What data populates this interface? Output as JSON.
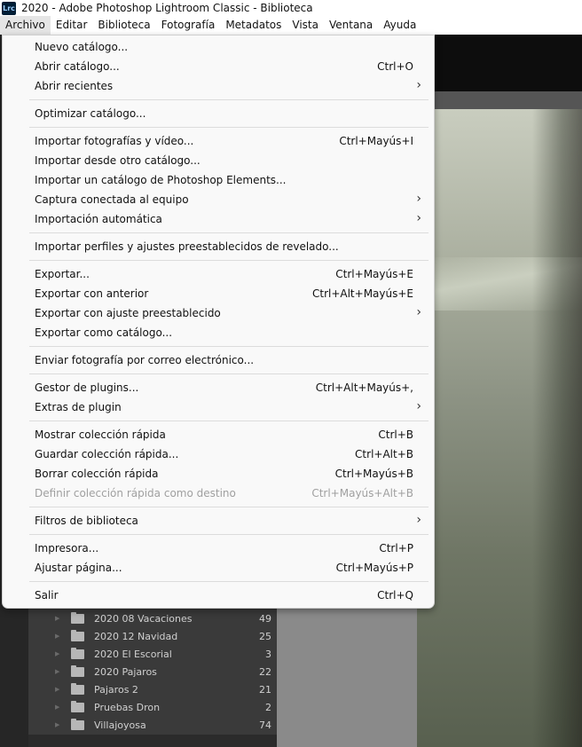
{
  "window": {
    "logo_text": "Lrc",
    "title": "2020 - Adobe Photoshop Lightroom Classic - Biblioteca"
  },
  "menubar": [
    "Archivo",
    "Editar",
    "Biblioteca",
    "Fotografía",
    "Metadatos",
    "Vista",
    "Ventana",
    "Ayuda"
  ],
  "archivo_menu": {
    "items": [
      {
        "label": "Nuevo catálogo...",
        "shortcut": ""
      },
      {
        "label": "Abrir catálogo...",
        "shortcut": "Ctrl+O"
      },
      {
        "label": "Abrir recientes",
        "shortcut": "",
        "submenu_arrow": "›"
      },
      {
        "label": "Optimizar catálogo...",
        "shortcut": ""
      },
      {
        "label": "Importar fotografías y vídeo...",
        "shortcut": "Ctrl+Mayús+I"
      },
      {
        "label": "Importar desde otro catálogo...",
        "shortcut": ""
      },
      {
        "label": "Importar un catálogo de Photoshop Elements...",
        "shortcut": ""
      },
      {
        "label": "Captura conectada al equipo",
        "shortcut": "",
        "submenu_arrow": "›"
      },
      {
        "label": "Importación automática",
        "shortcut": "",
        "submenu_arrow": "›"
      },
      {
        "label": "Importar perfiles y ajustes preestablecidos de revelado...",
        "shortcut": ""
      },
      {
        "label": "Exportar...",
        "shortcut": "Ctrl+Mayús+E"
      },
      {
        "label": "Exportar con anterior",
        "shortcut": "Ctrl+Alt+Mayús+E"
      },
      {
        "label": "Exportar con ajuste preestablecido",
        "shortcut": "",
        "submenu_arrow": "›"
      },
      {
        "label": "Exportar como catálogo...",
        "shortcut": ""
      },
      {
        "label": "Enviar fotografía por correo electrónico...",
        "shortcut": ""
      },
      {
        "label": "Gestor de plugins...",
        "shortcut": "Ctrl+Alt+Mayús+,"
      },
      {
        "label": "Extras de plugin",
        "shortcut": "",
        "submenu_arrow": "›"
      },
      {
        "label": "Mostrar colección rápida",
        "shortcut": "Ctrl+B"
      },
      {
        "label": "Guardar colección rápida...",
        "shortcut": "Ctrl+Alt+B"
      },
      {
        "label": "Borrar colección rápida",
        "shortcut": "Ctrl+Mayús+B"
      },
      {
        "label": "Definir colección rápida como destino",
        "shortcut": "Ctrl+Mayús+Alt+B",
        "disabled": true
      },
      {
        "label": "Filtros de biblioteca",
        "shortcut": "",
        "submenu_arrow": "›"
      },
      {
        "label": "Impresora...",
        "shortcut": "Ctrl+P"
      },
      {
        "label": "Ajustar página...",
        "shortcut": "Ctrl+Mayús+P"
      },
      {
        "label": "Salir",
        "shortcut": "Ctrl+Q"
      }
    ]
  },
  "folders": [
    {
      "name": "2020 08 Vacaciones",
      "count": "49"
    },
    {
      "name": "2020 12 Navidad",
      "count": "25"
    },
    {
      "name": "2020 El Escorial",
      "count": "3"
    },
    {
      "name": "2020 Pajaros",
      "count": "22"
    },
    {
      "name": "Pajaros 2",
      "count": "21"
    },
    {
      "name": "Pruebas Dron",
      "count": "2"
    },
    {
      "name": "Villajoyosa",
      "count": "74"
    }
  ],
  "icons": {
    "app_logo": "lightroom-logo",
    "folder": "folder-icon",
    "expand": "disclosure-triangle-icon"
  }
}
